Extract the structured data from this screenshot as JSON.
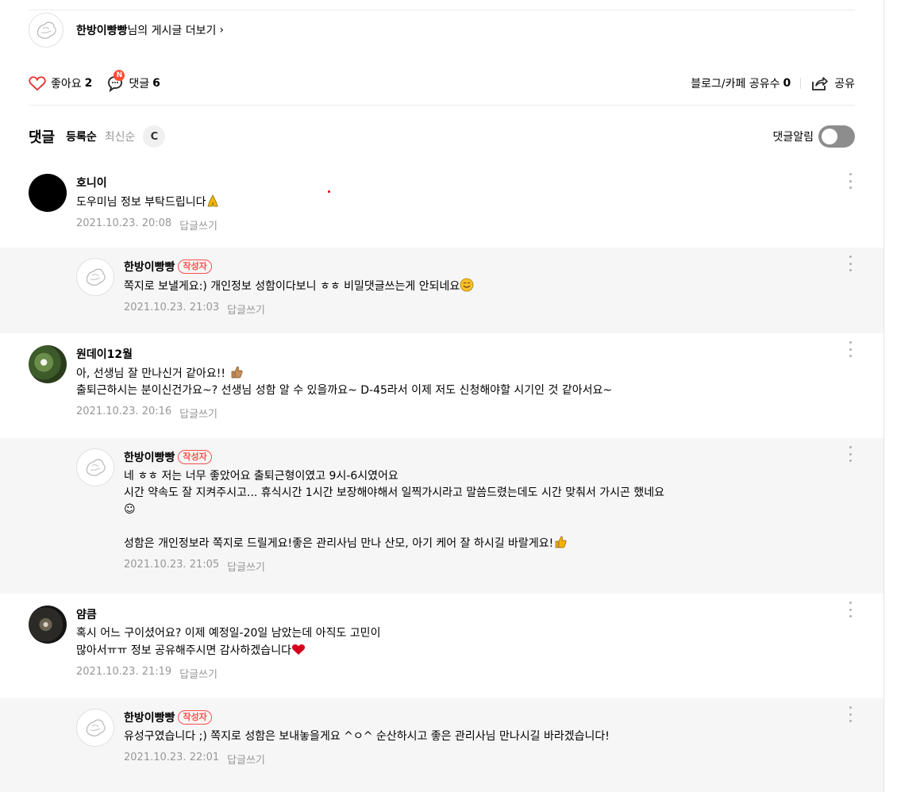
{
  "author_more": {
    "name": "한방이빵빵",
    "suffix": "님의 게시글 더보기",
    "chevron": "›"
  },
  "actions": {
    "like_label": "좋아요",
    "like_count": "2",
    "comment_badge": "N",
    "comment_label": "댓글",
    "comment_count": "6",
    "share_count_label": "블로그/카페 공유수",
    "share_count": "0",
    "share_label": "공유"
  },
  "comments_header": {
    "title": "댓글",
    "sort_registered": "등록순",
    "sort_latest": "최신순",
    "refresh_icon": "C",
    "notification_label": "댓글알림"
  },
  "comments": [
    {
      "nick": "호니이",
      "author_badge": "",
      "text": "도우미님 정보 부탁드립니다",
      "emoji": "folded-hands",
      "date": "2021.10.23. 20:08",
      "reply_label": "답글쓰기",
      "avatar": "black"
    },
    {
      "nick": "한방이빵빵",
      "author_badge": "작성자",
      "text": "쪽지로 보낼게요:) 개인정보 성함이다보니 ㅎㅎ 비밀댓글쓰는게 안되네요",
      "emoji": "smiling-face",
      "date": "2021.10.23. 21:03",
      "reply_label": "답글쓰기",
      "avatar": "sketch"
    },
    {
      "nick": "원데이12월",
      "author_badge": "",
      "text": "아, 선생님 잘 만나신거 같아요!! ",
      "text2": "출퇴근하시는 분이신건가요~? 선생님 성함 알 수 있을까요~ D-45라서 이제 저도 신청해야할 시기인 것 같아서요~",
      "emoji": "thumbs-up-brown",
      "date": "2021.10.23. 20:16",
      "reply_label": "답글쓰기",
      "avatar": "flowers"
    },
    {
      "nick": "한방이빵빵",
      "author_badge": "작성자",
      "text": "네 ㅎㅎ 저는 너무 좋았어요 출퇴근형이였고 9시-6시였어요\n시간 약속도 잘 지켜주시고... 휴식시간 1시간 보장해야해서 일찍가시라고 말씀드렸는데도 시간 맞춰서 가시곤 했네요\n☺\n\n성함은 개인정보라 쪽지로 드릴게요!좋은 관리사님 만나 산모, 아기 케어 잘 하시길 바랄게요!",
      "emoji": "thumbs-up-yellow",
      "date": "2021.10.23. 21:05",
      "reply_label": "답글쓰기",
      "avatar": "sketch"
    },
    {
      "nick": "얌큼",
      "author_badge": "",
      "text": "혹시 어느 구이셨어요? 이제 예정일-20일 남았는데 아직도 고민이\n많아서ㅠㅠ 정보 공유해주시면 감사하겠습니다",
      "emoji": "red-heart",
      "date": "2021.10.23. 21:19",
      "reply_label": "답글쓰기",
      "avatar": "night"
    },
    {
      "nick": "한방이빵빵",
      "author_badge": "작성자",
      "text": "유성구였습니다 ;) 쪽지로 성함은 보내놓을게요 ^ㅇ^ 순산하시고 좋은 관리사님 만나시길 바라겠습니다!",
      "emoji": "",
      "date": "2021.10.23. 22:01",
      "reply_label": "답글쓰기",
      "avatar": "sketch"
    }
  ]
}
